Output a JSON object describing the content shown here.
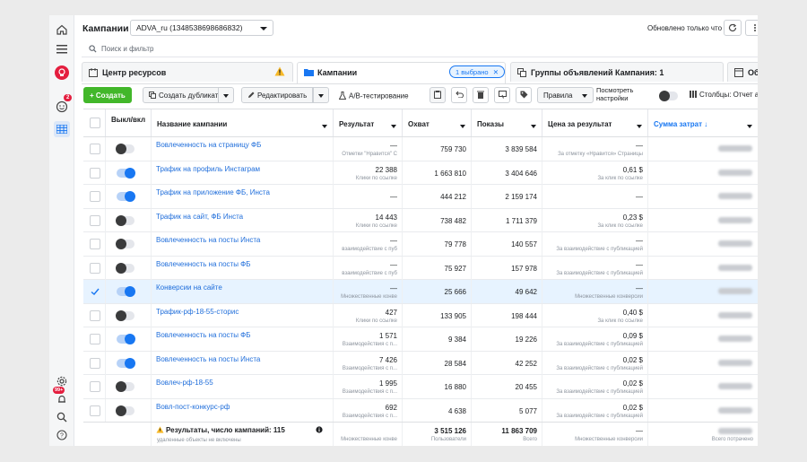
{
  "header": {
    "title": "Кампании",
    "account": "ADVA_ru (134853869868683​2)",
    "updated": "Обновлено только что"
  },
  "rail": {
    "badge_notifications": "2",
    "badge_alerts": "99+"
  },
  "search": {
    "placeholder": "Поиск и фильтр"
  },
  "tabs": {
    "resources": "Центр ресурсов",
    "campaigns": "Кампании",
    "selected_chip": "1 выбрано",
    "adsets": "Группы объявлений Кампания: 1",
    "ads": "Об"
  },
  "toolbar": {
    "create": "+ Создать",
    "duplicate": "Создать дубликат",
    "edit": "Редактировать",
    "ab_test": "А/В-тестирование",
    "rules": "Правила",
    "view_settings_1": "Посмотреть",
    "view_settings_2": "настройки",
    "columns": "Столбцы: Отчет ад"
  },
  "columns": {
    "toggle": "Выкл/вкл",
    "name": "Название кампании",
    "result": "Результат",
    "reach": "Охват",
    "impressions": "Показы",
    "cost_per_result": "Цена за результат",
    "spend": "Сумма затрат ↓"
  },
  "rows": [
    {
      "name": "Вовлеченность на страницу ФБ",
      "on": false,
      "checked": false,
      "result": "—",
      "result_sub": "Отметки \"Нравится\" С",
      "reach": "759 730",
      "impr": "3 839 584",
      "cpr": "—",
      "cpr_sub": "За отметку «Нравится» Страницы"
    },
    {
      "name": "Трафик на профиль Инстаграм",
      "on": true,
      "checked": false,
      "result": "22 388",
      "result_sub": "Клики по ссылке",
      "reach": "1 663 810",
      "impr": "3 404 646",
      "cpr": "0,61 $",
      "cpr_sub": "За клик по ссылке"
    },
    {
      "name": "Трафик на приложение ФБ, Инста",
      "on": true,
      "checked": false,
      "result": "—",
      "result_sub": "",
      "reach": "444 212",
      "impr": "2 159 174",
      "cpr": "—",
      "cpr_sub": ""
    },
    {
      "name": "Трафик на сайт, ФБ Инста",
      "on": false,
      "checked": false,
      "result": "14 443",
      "result_sub": "Клики по ссылке",
      "reach": "738 482",
      "impr": "1 711 379",
      "cpr": "0,23 $",
      "cpr_sub": "За клик по ссылке"
    },
    {
      "name": "Вовлеченность на посты Инста",
      "on": false,
      "checked": false,
      "result": "—",
      "result_sub": "взаимодействие с пуб",
      "reach": "79 778",
      "impr": "140 557",
      "cpr": "—",
      "cpr_sub": "За взаимодействие с публикацией"
    },
    {
      "name": "Вовлеченность на посты ФБ",
      "on": false,
      "checked": false,
      "result": "—",
      "result_sub": "взаимодействие с пуб",
      "reach": "75 927",
      "impr": "157 978",
      "cpr": "—",
      "cpr_sub": "За взаимодействие с публикацией"
    },
    {
      "name": "Конверсии на сайте",
      "on": true,
      "checked": true,
      "result": "—",
      "result_sub": "Множественные конве",
      "reach": "25 666",
      "impr": "49 642",
      "cpr": "—",
      "cpr_sub": "Множественные конверсии"
    },
    {
      "name": "Трафик-рф-18-55-сторис",
      "on": false,
      "checked": false,
      "result": "427",
      "result_sub": "Клики по ссылке",
      "reach": "133 905",
      "impr": "198 444",
      "cpr": "0,40 $",
      "cpr_sub": "За клик по ссылке"
    },
    {
      "name": "Вовлеченность на посты ФБ",
      "on": true,
      "checked": false,
      "result": "1 571",
      "result_sub": "Взаимодействия с п...",
      "reach": "9 384",
      "impr": "19 226",
      "cpr": "0,09 $",
      "cpr_sub": "За взаимодействие с публикацией"
    },
    {
      "name": "Вовлеченность на посты Инста",
      "on": true,
      "checked": false,
      "result": "7 426",
      "result_sub": "Взаимодействия с п...",
      "reach": "28 584",
      "impr": "42 252",
      "cpr": "0,02 $",
      "cpr_sub": "За взаимодействие с публикацией"
    },
    {
      "name": "Вовлеч-рф-18-55",
      "on": false,
      "checked": false,
      "result": "1 995",
      "result_sub": "Взаимодействия с п...",
      "reach": "16 880",
      "impr": "20 455",
      "cpr": "0,02 $",
      "cpr_sub": "За взаимодействие с публикацией"
    },
    {
      "name": "Вовл-пост-конкурс-рф",
      "on": false,
      "checked": false,
      "result": "692",
      "result_sub": "Взаимодействия с п...",
      "reach": "4 638",
      "impr": "5 077",
      "cpr": "0,02 $",
      "cpr_sub": "За взаимодействие с публикацией"
    }
  ],
  "footer": {
    "summary": "Результаты, число кампаний: 115",
    "summary_sub": "удаленные объекты не включены",
    "result_sub": "Множественные конве",
    "reach": "3 515 126",
    "reach_sub": "Пользователи",
    "impr": "11 863 709",
    "impr_sub": "Всего",
    "cpr_sub": "Множественные конверсии",
    "spend_sub": "Всего потрачено"
  },
  "colors": {
    "accent": "#1877f2",
    "create": "#42b72a",
    "warning": "#f7b928",
    "badge": "#e41e3f"
  }
}
